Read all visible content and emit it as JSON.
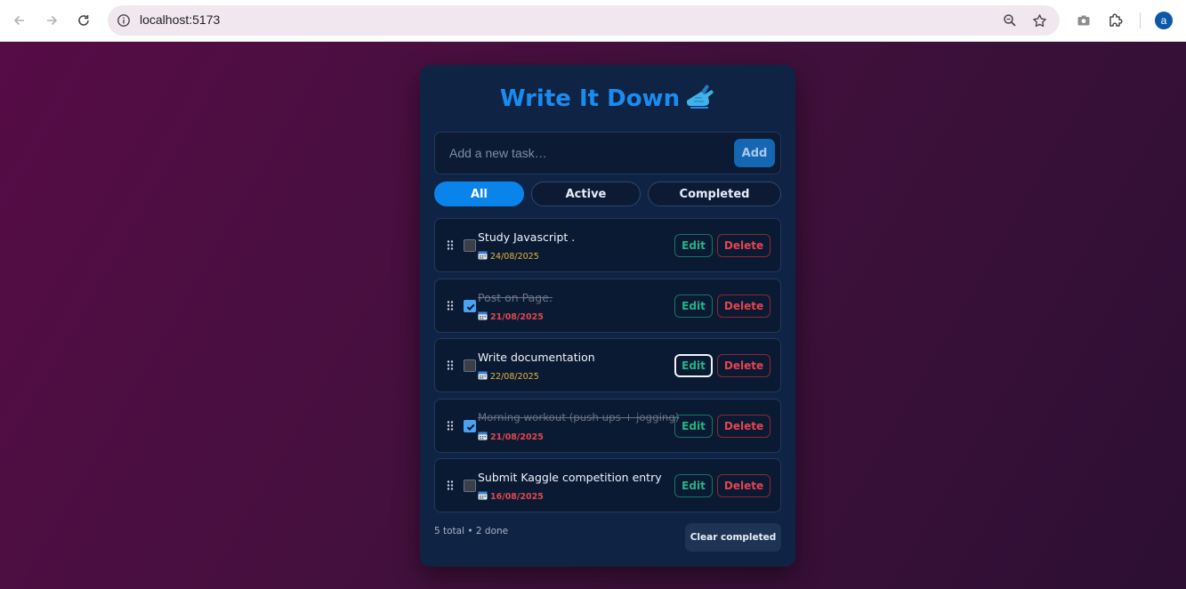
{
  "browser": {
    "url": "localhost:5173",
    "profile_initial": "a",
    "icons": [
      "back-icon",
      "forward-icon",
      "reload-icon",
      "site-info-icon",
      "zoom-icon",
      "bookmark-star-icon",
      "screenshot-icon",
      "extensions-icon"
    ]
  },
  "app": {
    "title": "Write It Down",
    "title_emoji": "✍",
    "input_placeholder": "Add a new task…",
    "add_label": "Add",
    "filters": [
      {
        "label": "All",
        "active": true
      },
      {
        "label": "Active",
        "active": false
      },
      {
        "label": "Completed",
        "active": false
      }
    ],
    "tasks": [
      {
        "title": "Study Javascript .",
        "date": "24/08/2025",
        "done": false,
        "overdue": false
      },
      {
        "title": "Post on Page.",
        "date": "21/08/2025",
        "done": true,
        "overdue": true
      },
      {
        "title": "Write documentation",
        "date": "22/08/2025",
        "done": false,
        "overdue": false
      },
      {
        "title": "Morning workout (push ups + jogging)",
        "date": "21/08/2025",
        "done": true,
        "overdue": true
      },
      {
        "title": "Submit Kaggle competition entry",
        "date": "16/08/2025",
        "done": false,
        "overdue": true
      }
    ],
    "edit_label": "Edit",
    "delete_label": "Delete",
    "summary": "5 total • 2 done",
    "clear_completed_label": "Clear completed",
    "colors": {
      "accent": "#0a84ea",
      "title": "#1a8cf0",
      "edit": "#23b487",
      "delete": "#e5444f",
      "date_ok": "#e6b63a",
      "date_overdue": "#e0474f"
    }
  }
}
